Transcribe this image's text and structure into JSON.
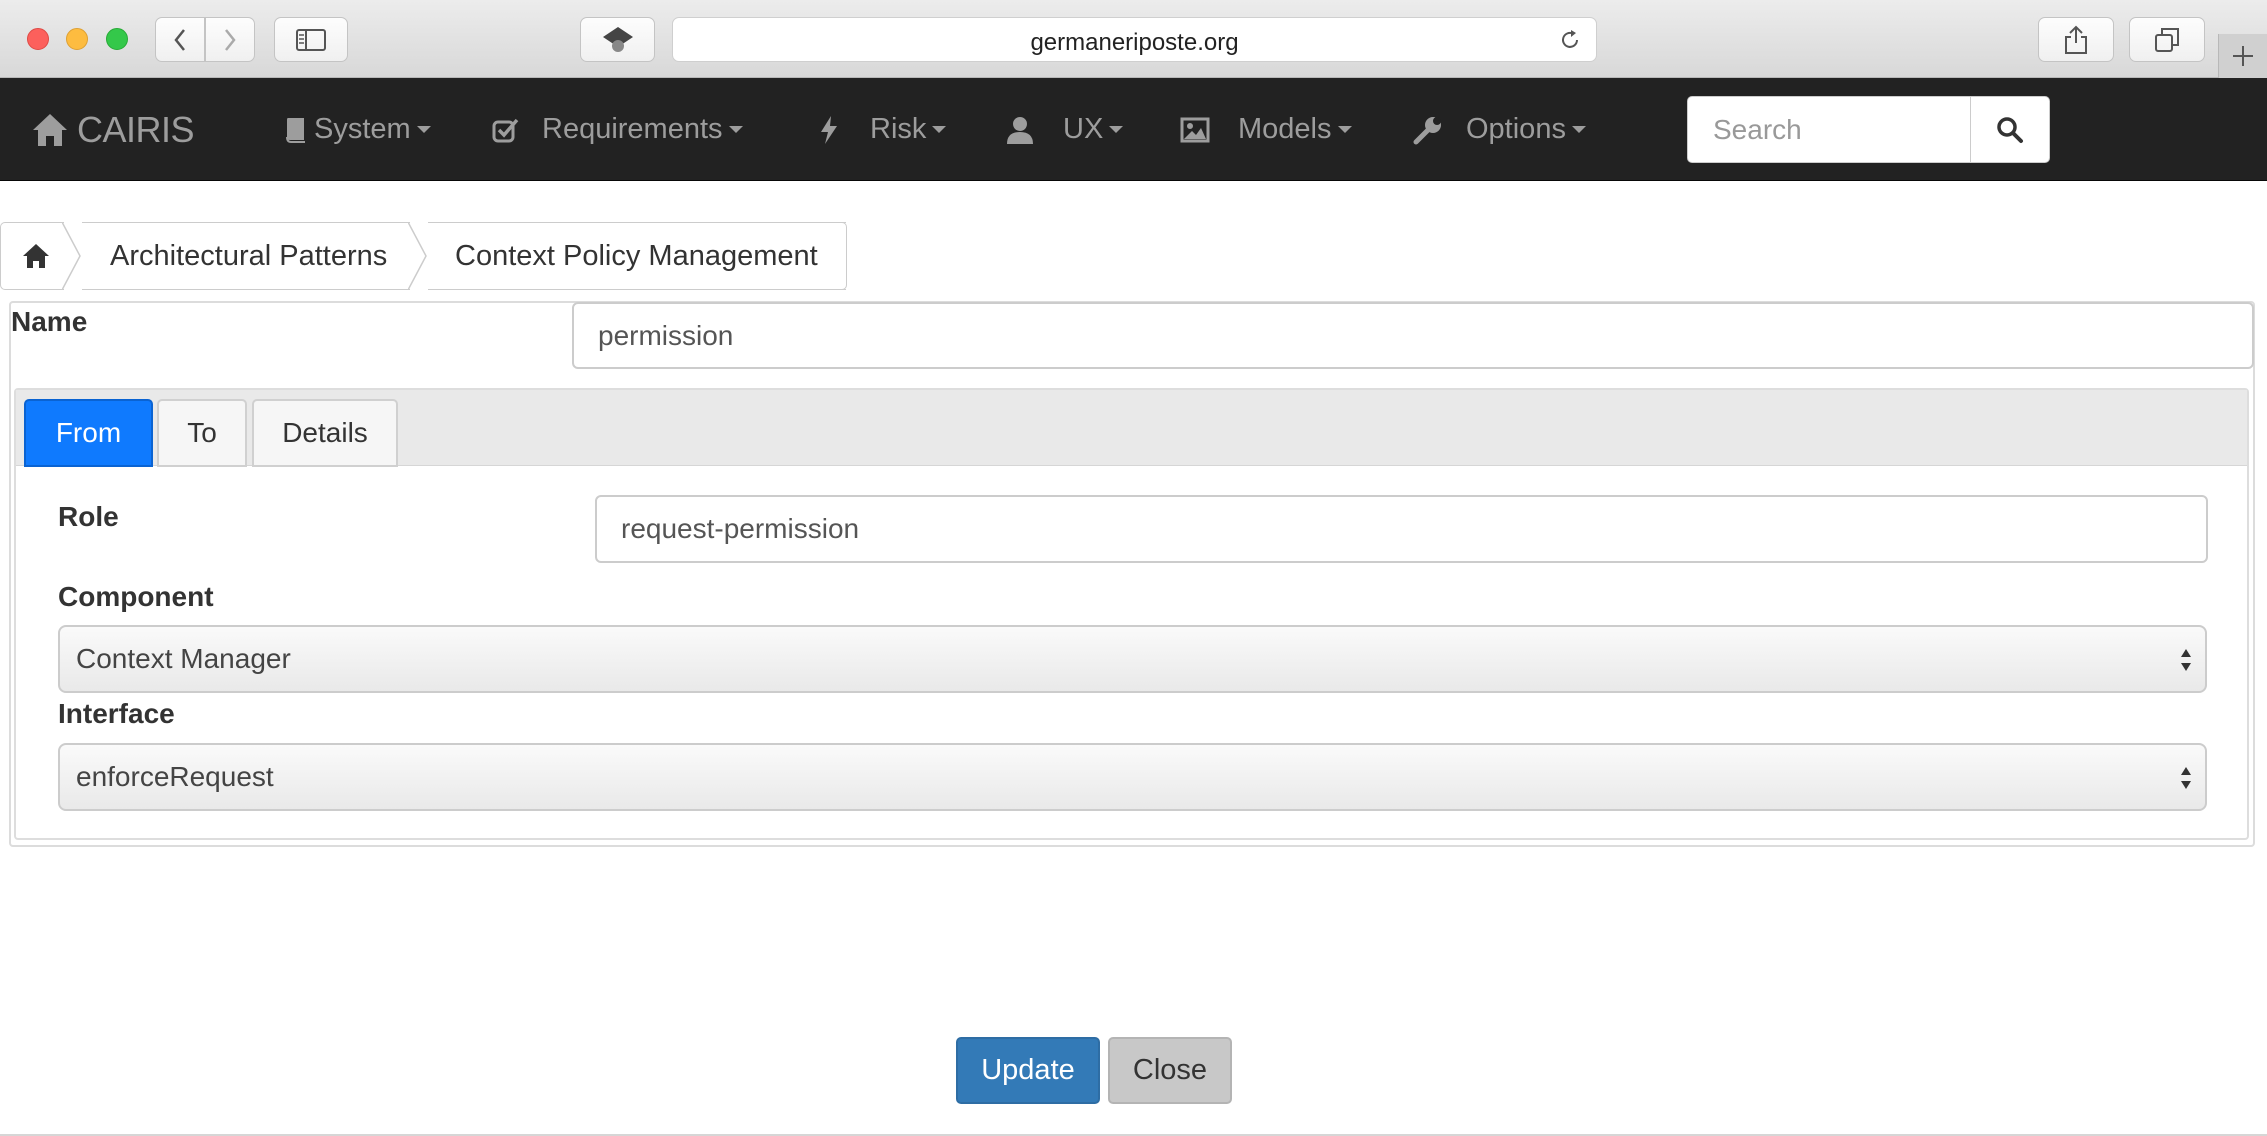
{
  "browser": {
    "url": "germaneriposte.org"
  },
  "navbar": {
    "brand": "CAIRIS",
    "menus": [
      {
        "label": "System"
      },
      {
        "label": "Requirements"
      },
      {
        "label": "Risk"
      },
      {
        "label": "UX"
      },
      {
        "label": "Models"
      },
      {
        "label": "Options"
      }
    ],
    "search_placeholder": "Search"
  },
  "breadcrumb": {
    "items": [
      "Architectural Patterns",
      "Context Policy Management"
    ]
  },
  "form": {
    "name_label": "Name",
    "name_value": "permission",
    "tabs": [
      {
        "label": "From",
        "active": true
      },
      {
        "label": "To",
        "active": false
      },
      {
        "label": "Details",
        "active": false
      }
    ],
    "role_label": "Role",
    "role_value": "request-permission",
    "component_label": "Component",
    "component_value": "Context Manager",
    "interface_label": "Interface",
    "interface_value": "enforceRequest"
  },
  "actions": {
    "update_label": "Update",
    "close_label": "Close"
  },
  "colors": {
    "navbar_bg": "#222222",
    "active_tab": "#0f7afe",
    "primary_button": "#337ab7"
  }
}
